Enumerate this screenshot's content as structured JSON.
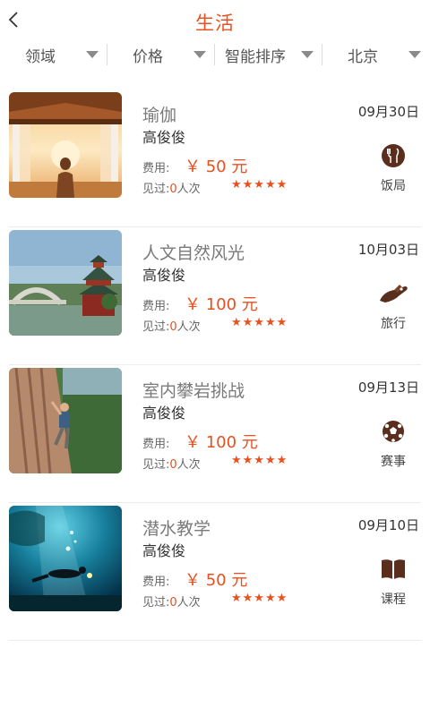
{
  "header": {
    "title": "生活"
  },
  "filters": [
    {
      "label": "领域"
    },
    {
      "label": "价格"
    },
    {
      "label": "智能排序"
    },
    {
      "label": "北京"
    }
  ],
  "fee_label": "费用:",
  "seen_prefix": "见过:",
  "seen_suffix": "人次",
  "items": [
    {
      "name": "瑜伽",
      "host": "高俊俊",
      "price": "￥ 50 元",
      "seen_count": "0",
      "stars": "★★★★★",
      "rating": 5,
      "date": "09月30日",
      "category": "饭局",
      "category_icon": "dining-icon",
      "image": "yoga-image"
    },
    {
      "name": "人文自然风光",
      "host": "高俊俊",
      "price": "￥ 100 元",
      "seen_count": "0",
      "stars": "★★★★★",
      "rating": 5,
      "date": "10月03日",
      "category": "旅行",
      "category_icon": "travel-icon",
      "image": "landscape-image"
    },
    {
      "name": "室内攀岩挑战",
      "host": "高俊俊",
      "price": "￥ 100 元",
      "seen_count": "0",
      "stars": "★★★★★",
      "rating": 5,
      "date": "09月13日",
      "category": "赛事",
      "category_icon": "soccer-ball-icon",
      "image": "climbing-image"
    },
    {
      "name": "潜水教学",
      "host": "高俊俊",
      "price": "￥ 50 元",
      "seen_count": "0",
      "stars": "★★★★★",
      "rating": 5,
      "date": "09月10日",
      "category": "课程",
      "category_icon": "book-icon",
      "image": "diving-image"
    }
  ],
  "colors": {
    "accent": "#e8501f",
    "caret": "#8a8a8a",
    "icon": "#5a2e1d"
  }
}
